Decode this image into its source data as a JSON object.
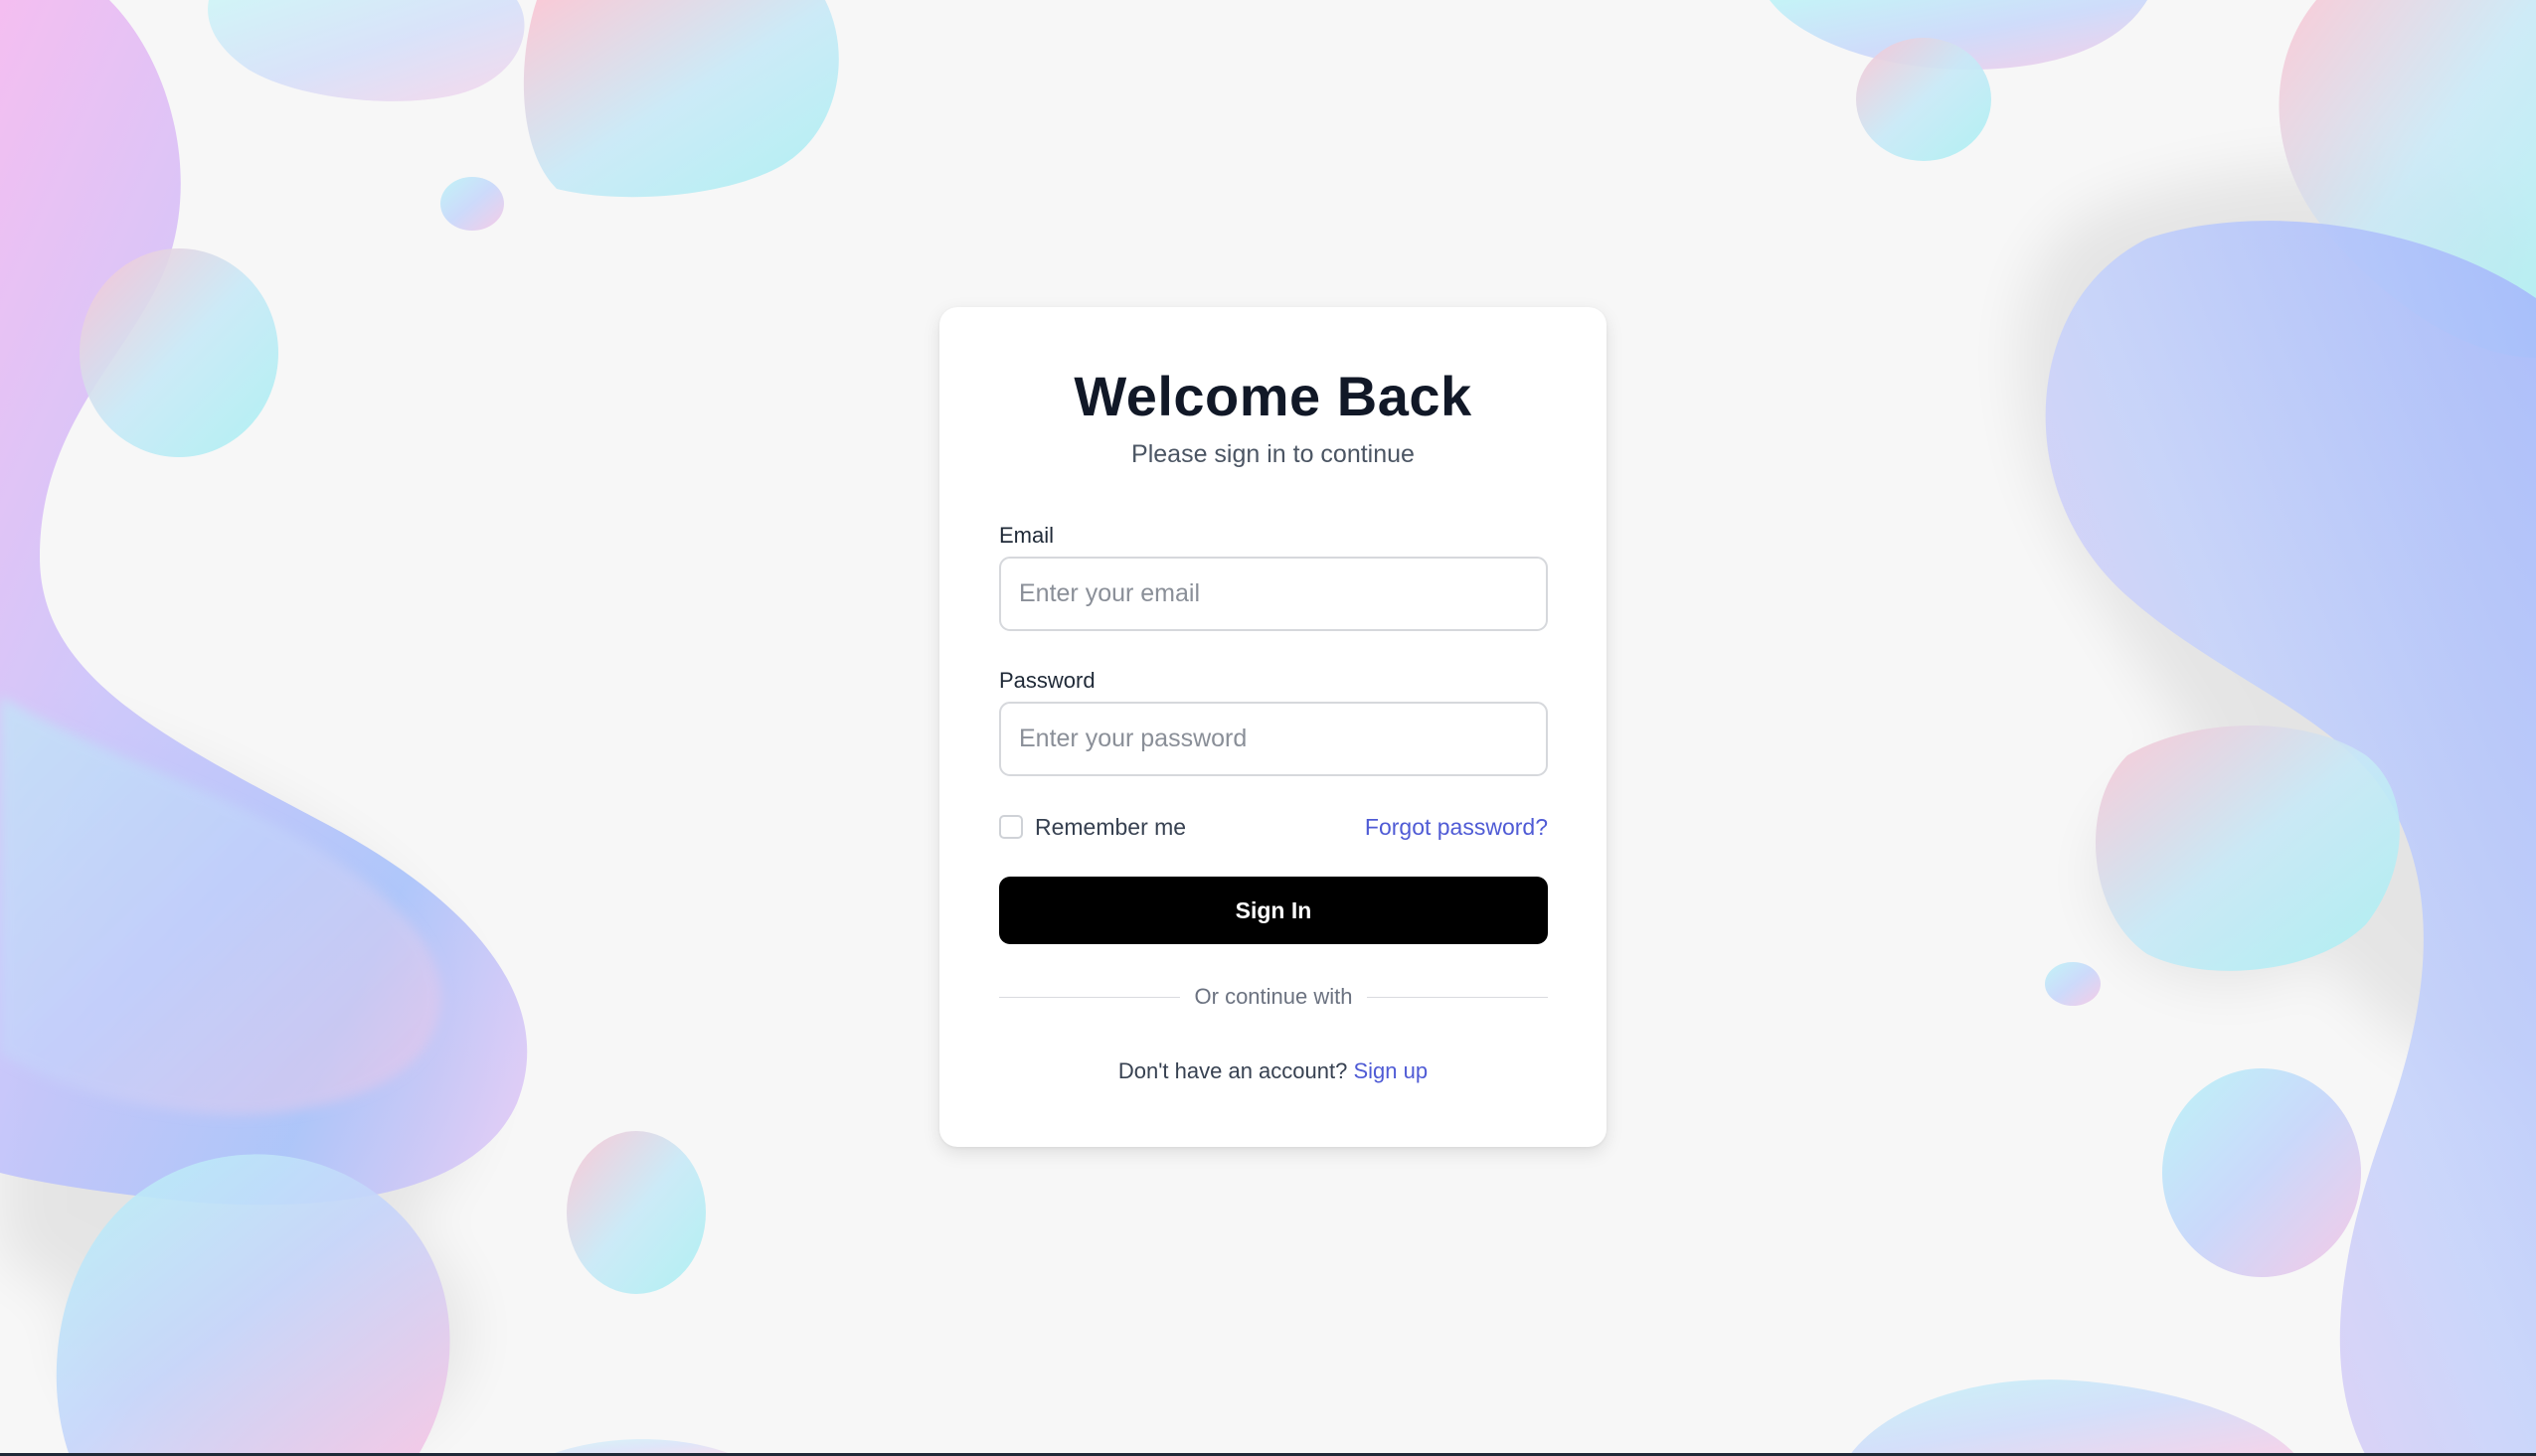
{
  "colors": {
    "background": "#f7f7f7",
    "card": "#ffffff",
    "primary_button": "#000000",
    "link": "#4f5bd5",
    "title": "#111827"
  },
  "login": {
    "title": "Welcome Back",
    "subtitle": "Please sign in to continue",
    "email": {
      "label": "Email",
      "placeholder": "Enter your email",
      "value": ""
    },
    "password": {
      "label": "Password",
      "placeholder": "Enter your password",
      "value": ""
    },
    "remember_me": {
      "label": "Remember me",
      "checked": false
    },
    "forgot_password_label": "Forgot password?",
    "sign_in_label": "Sign In",
    "divider_text": "Or continue with",
    "signup_prompt": "Don't have an account?",
    "signup_link_label": "Sign up"
  }
}
